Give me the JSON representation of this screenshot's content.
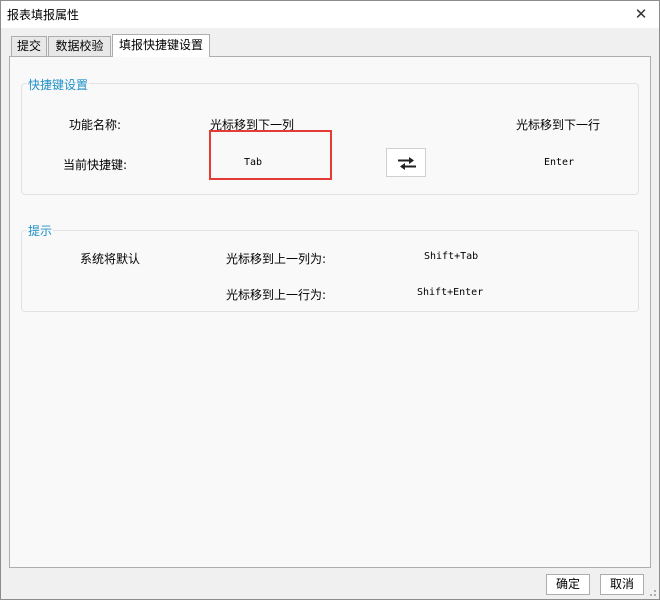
{
  "window": {
    "title": "报表填报属性"
  },
  "tabs": [
    {
      "label": "提交"
    },
    {
      "label": "数据校验"
    },
    {
      "label": "填报快捷键设置"
    }
  ],
  "shortcut_group": {
    "title": "快捷键设置",
    "function_name_label": "功能名称:",
    "function_col": "光标移到下一列",
    "function_row": "光标移到下一行",
    "current_key_label": "当前快捷键:",
    "col_key": "Tab",
    "row_key": "Enter"
  },
  "hint_group": {
    "title": "提示",
    "default_label": "系统将默认",
    "prev_col_label": "光标移到上一列为:",
    "prev_col_key": "Shift+Tab",
    "prev_row_label": "光标移到上一行为:",
    "prev_row_key": "Shift+Enter"
  },
  "buttons": {
    "ok": "确定",
    "cancel": "取消"
  },
  "colors": {
    "group_title": "#1e90c8",
    "highlight": "#e53b35"
  },
  "icons": {
    "swap": "swap-arrows-icon",
    "close": "close-icon"
  }
}
